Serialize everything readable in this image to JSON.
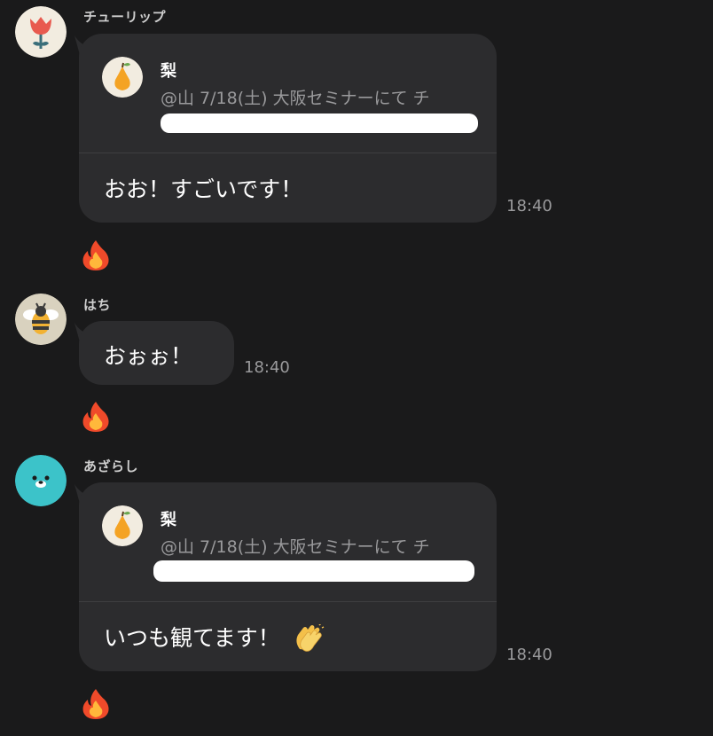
{
  "messages": [
    {
      "sender": "チューリップ",
      "avatar_icon": "tulip-icon",
      "quote": {
        "name": "梨",
        "avatar_icon": "pear-icon",
        "text": "@山 7/18(土) 大阪セミナーにて チ"
      },
      "text": "おお！すごいです！",
      "time": "18:40",
      "reaction": "fire-icon"
    },
    {
      "sender": "はち",
      "avatar_icon": "bee-icon",
      "text": "おぉぉ！",
      "time": "18:40",
      "reaction": "fire-icon"
    },
    {
      "sender": "あざらし",
      "avatar_icon": "seal-icon",
      "quote": {
        "name": "梨",
        "avatar_icon": "pear-icon",
        "text": "@山 7/18(土) 大阪セミナーにて チ"
      },
      "text": "いつも観てます！",
      "text_emoji": "clapping-hands-icon",
      "time": "18:40",
      "reaction": "fire-icon"
    }
  ],
  "colors": {
    "background": "#1a1a1b",
    "bubble": "#2c2c2e",
    "muted_text": "#9a9a9c"
  }
}
